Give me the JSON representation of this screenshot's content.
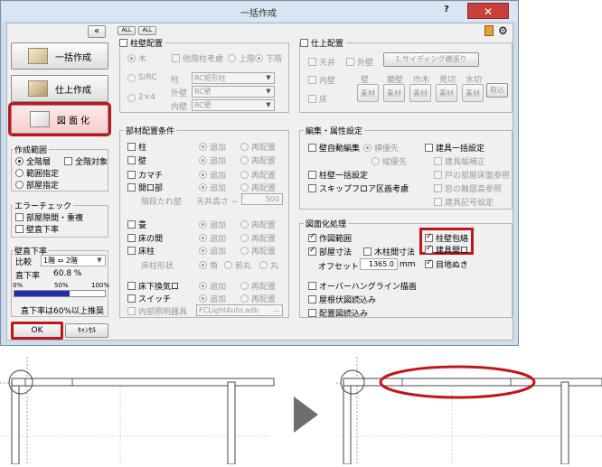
{
  "window": {
    "title": "一括作成",
    "help_label": "?",
    "close_label": "✕"
  },
  "toolbar": {
    "collapse_label": "«",
    "all_on_label": "ALL",
    "all_off_label": "ALL"
  },
  "left_buttons": [
    {
      "label": "一括作成",
      "icon": "building-icon"
    },
    {
      "label": "仕上作成",
      "icon": "finish-icon"
    },
    {
      "label": "図 面 化",
      "icon": "drawing-icon"
    }
  ],
  "scope": {
    "title": "作成範囲",
    "options": [
      "全階層",
      "全階対象",
      "範囲指定",
      "部屋指定"
    ]
  },
  "error": {
    "title": "エラーチェック",
    "items": [
      "部屋隙間・重複",
      "壁直下率"
    ]
  },
  "ratio": {
    "title": "壁直下率",
    "compare_label": "比較",
    "compare_value": "1階 ⇔ 2階",
    "ratio_label": "直下率",
    "ratio_value": "60.8 %",
    "scale": [
      "0%",
      "50%",
      "100%"
    ],
    "fill_fraction": 0.608,
    "note": "直下率は60%以上推奨"
  },
  "buttons": {
    "ok": "OK",
    "cancel": "ｷｬﾝｾﾙ"
  },
  "column_wall": {
    "title": "柱壁配置",
    "wood": "木",
    "rc": "S/RC",
    "two_by_four": "2×4",
    "other_floor": "他階柱考慮",
    "upper": "上階",
    "lower": "下階",
    "pillar_label": "柱",
    "pillar_value": "RC矩形柱",
    "outer_label": "外壁",
    "outer_value": "RC壁",
    "inner_label": "内壁",
    "inner_value": "RC壁"
  },
  "members": {
    "title": "部材配置条件",
    "add": "追加",
    "replace": "再配置",
    "rows": [
      {
        "label": "柱",
        "checked": false,
        "add": true
      },
      {
        "label": "壁",
        "checked": false,
        "add": true
      },
      {
        "label": "カマチ",
        "checked": false,
        "add": true
      },
      {
        "label": "開口部",
        "checked": false,
        "add": true
      },
      {
        "label": "畳",
        "checked": false,
        "add": true
      },
      {
        "label": "床の間",
        "checked": false,
        "add": true
      },
      {
        "label": "床柱",
        "checked": false,
        "add": true
      },
      {
        "label": "床下換気口",
        "checked": false,
        "add": true
      },
      {
        "label": "スイッチ",
        "checked": false,
        "add": true
      }
    ],
    "hanging_label": "階段たれ壁",
    "ceiling_label": "天井高さ −",
    "ceiling_value": "500",
    "post_shape_label": "床柱形状",
    "shapes": [
      "角",
      "前丸",
      "丸"
    ],
    "lighting_label": "内部照明器具",
    "lighting_value": "FCLightAuto.adb"
  },
  "finish": {
    "title": "仕上配置",
    "ceiling": "天井",
    "inner": "内壁",
    "floor": "床",
    "outer": "外壁",
    "siding_button": "1.サイディング横張り",
    "columns": [
      "壁",
      "鏡壁",
      "巾木",
      "見切",
      "水切"
    ],
    "material_label": "素材",
    "import_label": "取込"
  },
  "edit": {
    "title": "編集・属性設定",
    "auto_edit": "壁自動編集",
    "horizontal": "横優先",
    "vertical": "縦優先",
    "fitting_bulk": "建具一括設定",
    "fitting_width": "建具幅補正",
    "door_room": "戸の部屋床面参照",
    "window_height": "窓の触居高参照",
    "fitting_code": "建具記号設定",
    "pillar_wall_bulk": "柱壁一括設定",
    "skip_floor": "スキップフロア区画考慮"
  },
  "drawing": {
    "title": "図面化処理",
    "items": [
      {
        "label": "作図範囲",
        "checked": true
      },
      {
        "label": "部屋寸法",
        "checked": true
      },
      {
        "label": "木柱間寸法",
        "checked": false
      }
    ],
    "offset_label": "オフセット",
    "offset_value": "1365.0",
    "offset_unit": "mm",
    "right_items": [
      {
        "label": "柱壁包絡",
        "checked": true
      },
      {
        "label": "建具開口",
        "checked": true
      },
      {
        "label": "目地ぬき",
        "checked": true
      }
    ],
    "more": [
      "オーバーハングライン描画",
      "屋根伏図読込み",
      "配置図読込み"
    ]
  },
  "arrow": {
    "symbol": "▶"
  }
}
